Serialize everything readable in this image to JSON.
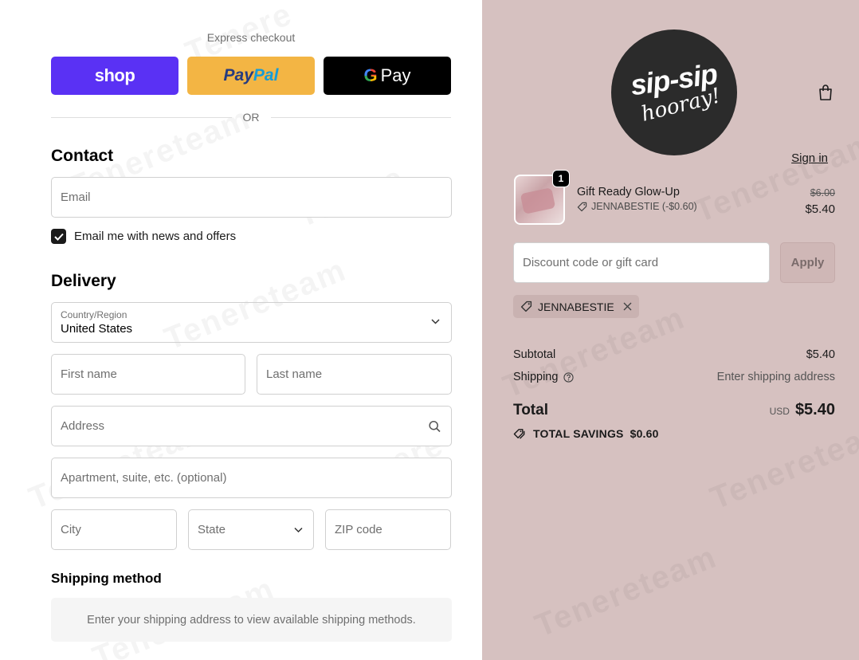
{
  "express": {
    "label": "Express checkout",
    "shop_label": "shop",
    "paypal_label_1": "Pay",
    "paypal_label_2": "Pal",
    "gpay_label": "Pay",
    "or_label": "OR"
  },
  "contact": {
    "title": "Contact",
    "sign_in": "Sign in",
    "email_placeholder": "Email",
    "newsletter_label": "Email me with news and offers",
    "newsletter_checked": true
  },
  "delivery": {
    "title": "Delivery",
    "country_label": "Country/Region",
    "country_value": "United States",
    "first_name_placeholder": "First name",
    "last_name_placeholder": "Last name",
    "address_placeholder": "Address",
    "apartment_placeholder": "Apartment, suite, etc. (optional)",
    "city_placeholder": "City",
    "state_placeholder": "State",
    "zip_placeholder": "ZIP code"
  },
  "shipping_method": {
    "title": "Shipping method",
    "message": "Enter your shipping address to view available shipping methods."
  },
  "store": {
    "logo_line1": "sip-sip",
    "logo_line2": "hooray!"
  },
  "cart": {
    "item": {
      "quantity": "1",
      "name": "Gift Ready Glow-Up",
      "discount": "JENNABESTIE (-$0.60)",
      "original_price": "$6.00",
      "price": "$5.40"
    },
    "discount_placeholder": "Discount code or gift card",
    "apply_label": "Apply",
    "applied_code": "JENNABESTIE",
    "subtotal_label": "Subtotal",
    "subtotal_value": "$5.40",
    "shipping_label": "Shipping",
    "shipping_value": "Enter shipping address",
    "total_label": "Total",
    "currency": "USD",
    "total_value": "$5.40",
    "savings_label": "TOTAL SAVINGS",
    "savings_value": "$0.60"
  },
  "colors": {
    "shop_purple": "#5a31f4",
    "paypal_yellow": "#f3b544",
    "sidebar_bg": "#d6c1c0"
  }
}
